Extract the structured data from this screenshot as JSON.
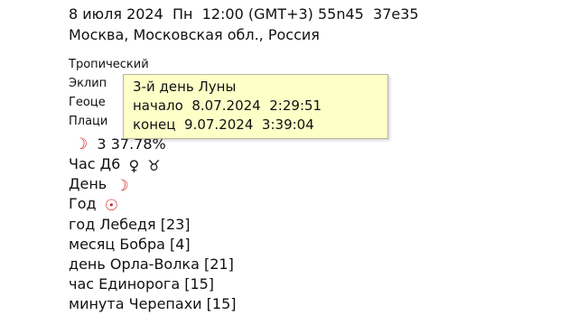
{
  "header": {
    "date": "8 июля 2024",
    "weekday": "Пн",
    "time": "12:00",
    "timezone": "(GMT+3)",
    "latitude": "55n45",
    "longitude": "37e35",
    "location": "Москва, Московская обл., Россия"
  },
  "settings": {
    "zodiac": "Тропический",
    "coords_partial": "Эклип",
    "center_partial": "Геоце",
    "houses_partial": "Плаци"
  },
  "moon": {
    "symbol": "☽",
    "day": "3",
    "phase_percent": "37.78%"
  },
  "hour": {
    "label": "Час Д6",
    "ruler_symbol": "♀",
    "sign_symbol": "♉"
  },
  "day": {
    "label": "День",
    "ruler_symbol": "☽"
  },
  "year": {
    "label": "Год",
    "ruler_symbol": "☉"
  },
  "animals": [
    "год Лебедя [23]",
    "месяц Бобра [4]",
    "день Орла-Волка [21]",
    "час Единорога [15]",
    "минута Черепахи [15]"
  ],
  "tooltip": {
    "title": "3-й день Луны",
    "start_label": "начало",
    "start_date": "8.07.2024",
    "start_time": "2:29:51",
    "end_label": "конец",
    "end_date": "9.07.2024",
    "end_time": "3:39:04"
  },
  "colors": {
    "symbol_red": "#d02020",
    "tooltip_bg": "#ffffc8"
  }
}
